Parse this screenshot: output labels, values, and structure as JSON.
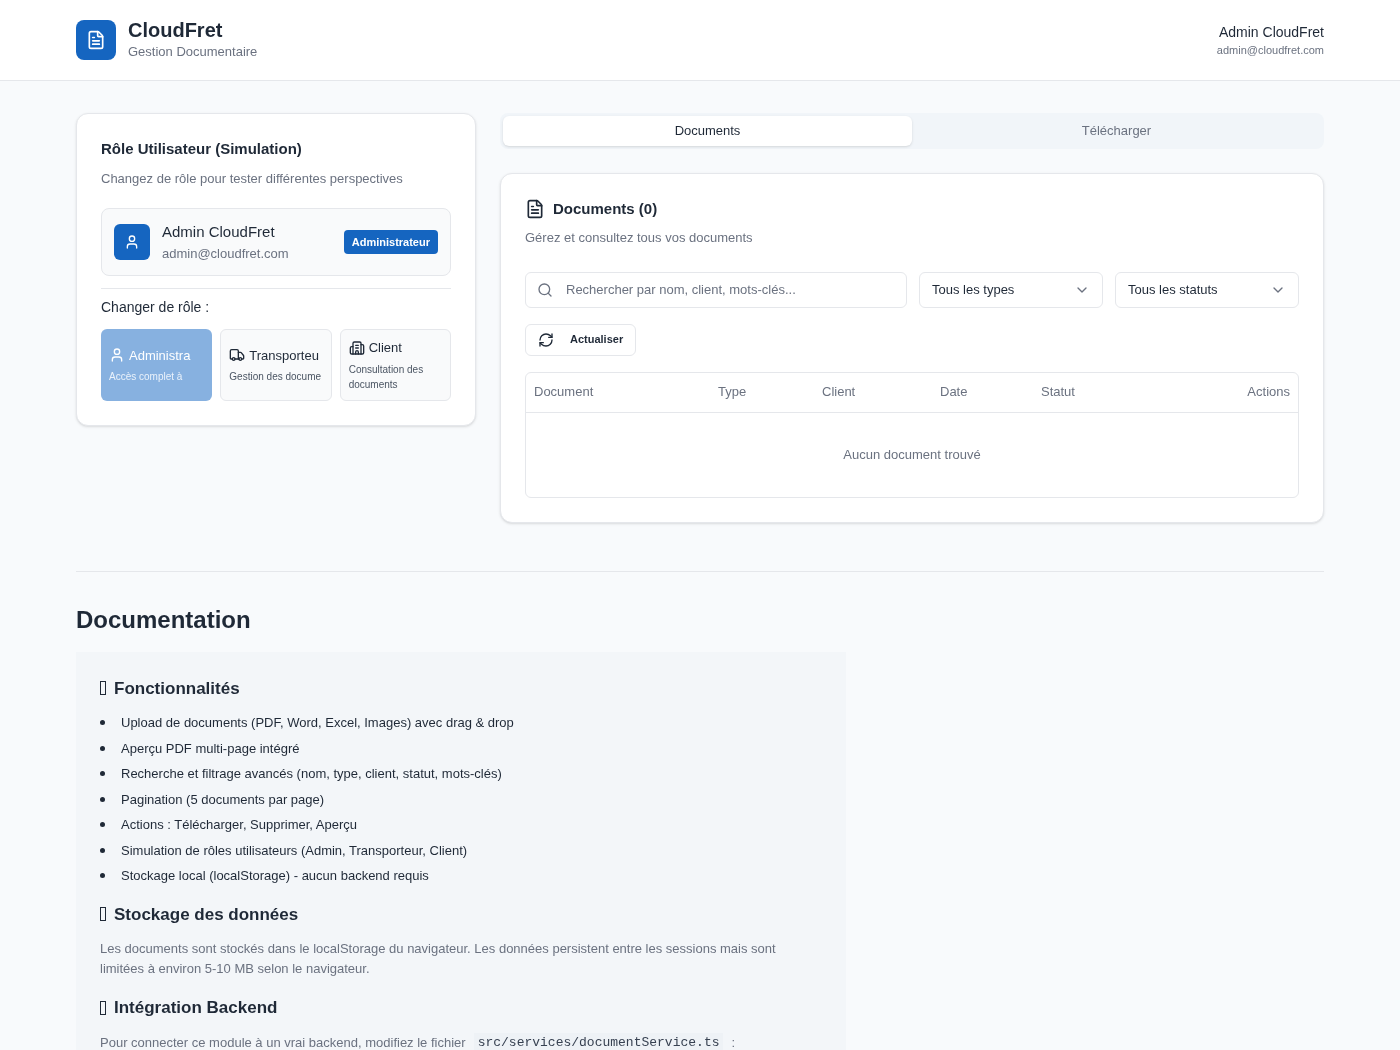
{
  "header": {
    "brand": "CloudFret",
    "subtitle": "Gestion Documentaire",
    "user_name": "Admin CloudFret",
    "user_email": "admin@cloudfret.com"
  },
  "role_panel": {
    "title": "Rôle Utilisateur (Simulation)",
    "description": "Changez de rôle pour tester différentes perspectives",
    "current_user": {
      "name": "Admin CloudFret",
      "email": "admin@cloudfret.com",
      "badge": "Administrateur"
    },
    "change_label": "Changer de rôle :",
    "roles": [
      {
        "kind": "admin",
        "label": "Administra",
        "description": "Accès complet à",
        "selected": true
      },
      {
        "kind": "carrier",
        "label": "Transporteu",
        "description": "Gestion des docume",
        "selected": false
      },
      {
        "kind": "client",
        "label": "Client",
        "description": "Consultation des documents",
        "selected": false
      }
    ]
  },
  "tabs": [
    {
      "label": "Documents",
      "selected": true
    },
    {
      "label": "Télécharger",
      "selected": false
    }
  ],
  "documents_panel": {
    "title": "Documents (0)",
    "description": "Gérez et consultez tous vos documents",
    "search": {
      "placeholder": "Rechercher par nom, client, mots-clés..."
    },
    "filters": [
      "Tous les types",
      "Tous les statuts"
    ],
    "refresh": "Actualiser",
    "table": {
      "columns": [
        "Document",
        "Type",
        "Client",
        "Date",
        "Statut",
        "Actions"
      ],
      "empty": "Aucun document trouvé"
    }
  },
  "documentation": {
    "title": "Documentation",
    "sections": [
      {
        "kind": "list",
        "heading": "Fonctionnalités",
        "items": [
          "Upload de documents (PDF, Word, Excel, Images) avec drag & drop",
          "Aperçu PDF multi-page intégré",
          "Recherche et filtrage avancés (nom, type, client, statut, mots-clés)",
          "Pagination (5 documents par page)",
          "Actions : Télécharger, Supprimer, Aperçu",
          "Simulation de rôles utilisateurs (Admin, Transporteur, Client)",
          "Stockage local (localStorage) - aucun backend requis"
        ]
      },
      {
        "kind": "text",
        "heading": "Stockage des données",
        "text": "Les documents sont stockés dans le localStorage du navigateur. Les données persistent entre les sessions mais sont limitées à environ 5-10 MB selon le navigateur."
      },
      {
        "kind": "code",
        "heading": "Intégration Backend",
        "text": "Pour connecter ce module à un vrai backend, modifiez le fichier",
        "code": "src/services/documentService.ts",
        "after": ":"
      }
    ]
  }
}
